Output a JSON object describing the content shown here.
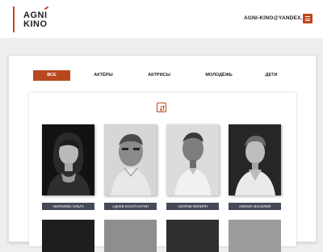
{
  "header": {
    "logo_line1": "AGNI",
    "logo_line2": "KINO",
    "email": "AGNI-KINO@YANDEX.RU",
    "brand_color": "#c0461c"
  },
  "tabs": [
    {
      "label": "ВСЕ",
      "active": true
    },
    {
      "label": "АКТЁРЫ",
      "active": false
    },
    {
      "label": "АКТРИСЫ",
      "active": false
    },
    {
      "label": "МОЛОДЁЖЬ",
      "active": false
    },
    {
      "label": "ДЕТИ",
      "active": false
    }
  ],
  "sort_icon": "sort-arrows-icon",
  "actors": [
    {
      "name": "АБРАМОВА ОЛЬГА"
    },
    {
      "name": "АДАЕВ КОНСТАНТИН"
    },
    {
      "name": "АЗАРОВ ФИЛИПП"
    },
    {
      "name": "АКИНИН ВАСИЛИЙ"
    }
  ]
}
